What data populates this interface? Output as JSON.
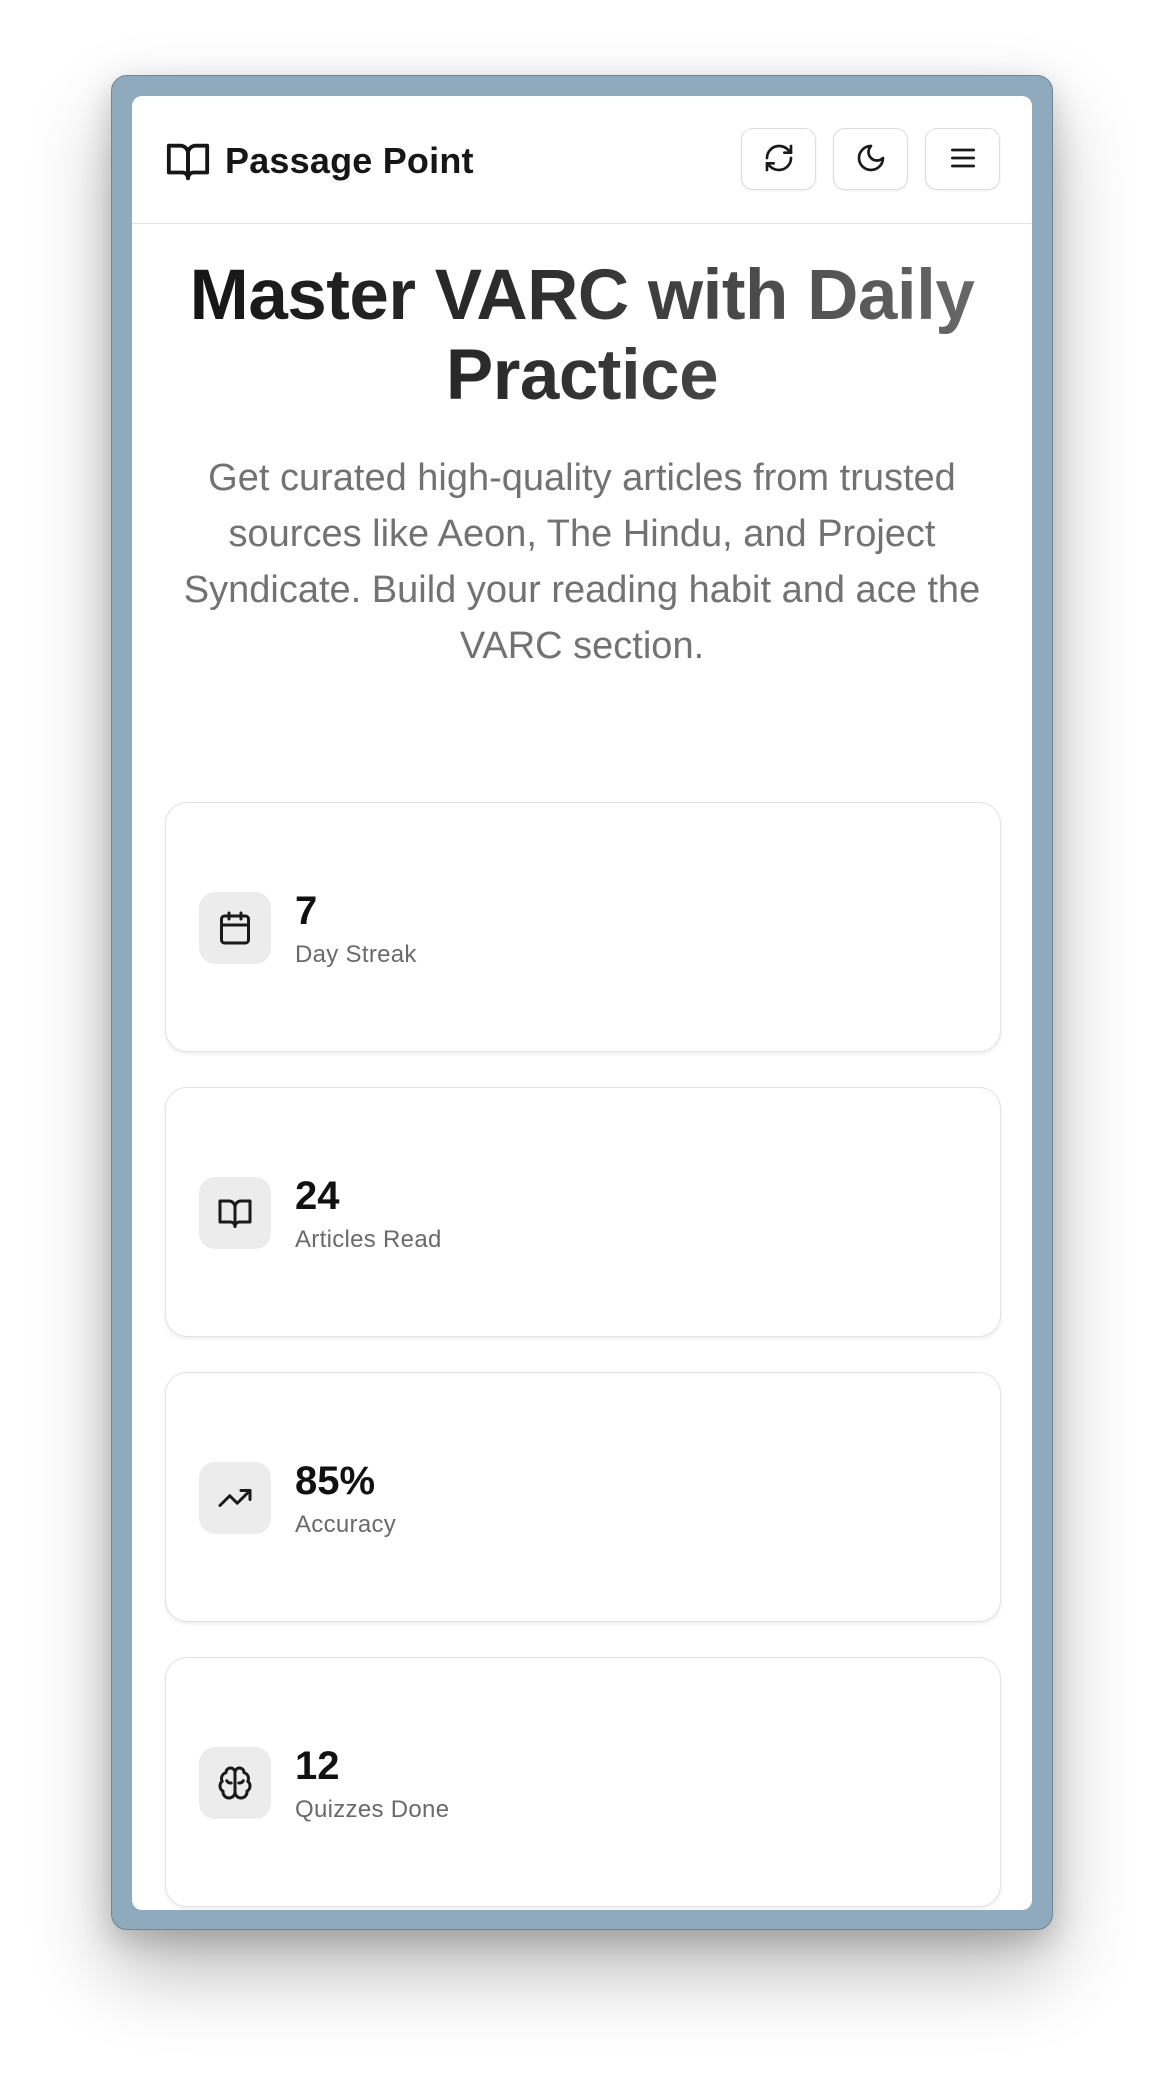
{
  "app": {
    "name": "Passage Point",
    "logo_icon": "open-book-icon"
  },
  "header_actions": [
    {
      "name": "refresh",
      "icon": "refresh-icon"
    },
    {
      "name": "theme-toggle",
      "icon": "moon-icon"
    },
    {
      "name": "menu",
      "icon": "hamburger-menu-icon"
    }
  ],
  "hero": {
    "title": "Master VARC with Daily Practice",
    "subtitle": "Get curated high-quality articles from trusted sources like Aeon, The Hindu, and Project Syndicate. Build your reading habit and ace the VARC section."
  },
  "stats": [
    {
      "value": "7",
      "label": "Day Streak",
      "icon": "calendar-icon"
    },
    {
      "value": "24",
      "label": "Articles Read",
      "icon": "open-book-icon"
    },
    {
      "value": "85%",
      "label": "Accuracy",
      "icon": "trending-up-icon"
    },
    {
      "value": "12",
      "label": "Quizzes Done",
      "icon": "brain-icon"
    }
  ],
  "colors": {
    "frame": "#8fa9bd",
    "card_border": "#e2e2e2",
    "icon_bg": "#ececec",
    "text_primary": "#111111",
    "text_muted": "#6a6a6a"
  }
}
